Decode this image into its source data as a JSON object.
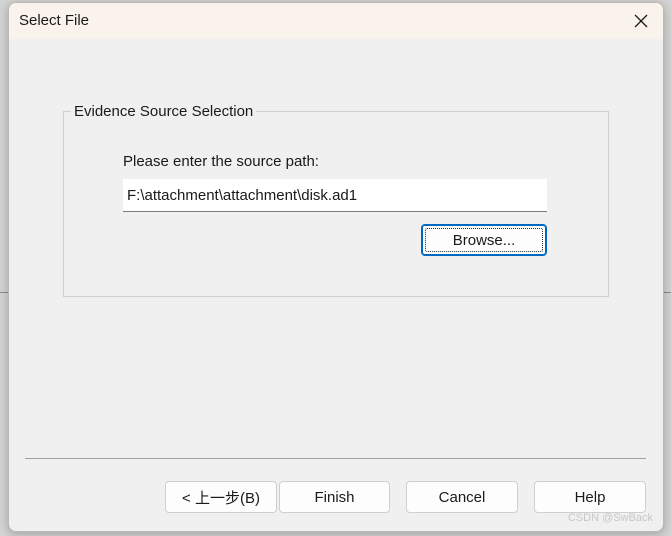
{
  "window": {
    "title": "Select File"
  },
  "group": {
    "legend": "Evidence Source Selection",
    "path_label": "Please enter the source path:",
    "path_value": "F:\\attachment\\attachment\\disk.ad1",
    "browse_label": "Browse..."
  },
  "footer": {
    "back_label": "< 上一步(B)",
    "finish_label": "Finish",
    "cancel_label": "Cancel",
    "help_label": "Help"
  },
  "watermark": "CSDN @SwBack",
  "icons": {
    "close": "close-icon"
  },
  "colors": {
    "titlebar_bg": "#faf3ec",
    "dialog_bg": "#f0f0f0",
    "focus_border": "#0067c0"
  }
}
